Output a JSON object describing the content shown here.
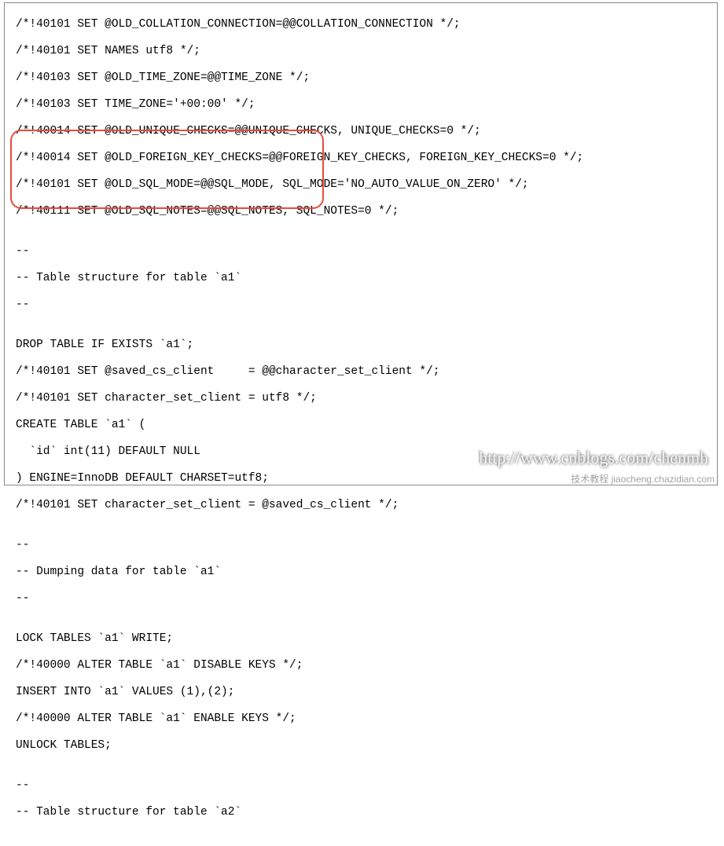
{
  "code": {
    "lines": [
      "/*!40101 SET @OLD_COLLATION_CONNECTION=@@COLLATION_CONNECTION */;",
      "/*!40101 SET NAMES utf8 */;",
      "/*!40103 SET @OLD_TIME_ZONE=@@TIME_ZONE */;",
      "/*!40103 SET TIME_ZONE='+00:00' */;",
      "/*!40014 SET @OLD_UNIQUE_CHECKS=@@UNIQUE_CHECKS, UNIQUE_CHECKS=0 */;",
      "/*!40014 SET @OLD_FOREIGN_KEY_CHECKS=@@FOREIGN_KEY_CHECKS, FOREIGN_KEY_CHECKS=0 */;",
      "/*!40101 SET @OLD_SQL_MODE=@@SQL_MODE, SQL_MODE='NO_AUTO_VALUE_ON_ZERO' */;",
      "/*!40111 SET @OLD_SQL_NOTES=@@SQL_NOTES, SQL_NOTES=0 */;",
      "",
      "--",
      "-- Table structure for table `a1`",
      "--",
      "",
      "DROP TABLE IF EXISTS `a1`;",
      "/*!40101 SET @saved_cs_client     = @@character_set_client */;",
      "/*!40101 SET character_set_client = utf8 */;",
      "CREATE TABLE `a1` (",
      "  `id` int(11) DEFAULT NULL",
      ") ENGINE=InnoDB DEFAULT CHARSET=utf8;",
      "/*!40101 SET character_set_client = @saved_cs_client */;",
      "",
      "--",
      "-- Dumping data for table `a1`",
      "--",
      "",
      "LOCK TABLES `a1` WRITE;",
      "/*!40000 ALTER TABLE `a1` DISABLE KEYS */;",
      "INSERT INTO `a1` VALUES (1),(2);",
      "/*!40000 ALTER TABLE `a1` ENABLE KEYS */;",
      "UNLOCK TABLES;",
      "",
      "--",
      "-- Table structure for table `a2`"
    ]
  },
  "watermark": {
    "url": "http://www.cnblogs.com/chenmh",
    "small": "技术教程  jiaocheng.chazidian.com"
  }
}
